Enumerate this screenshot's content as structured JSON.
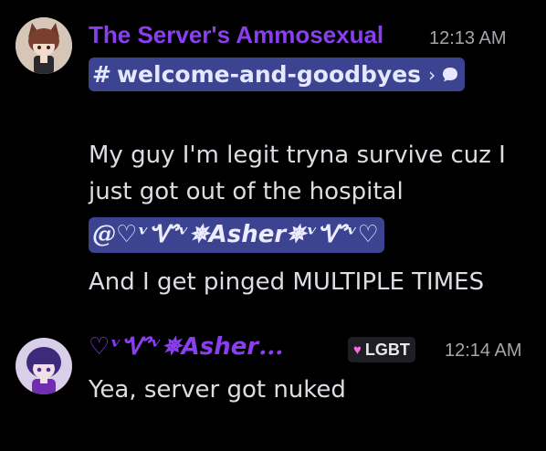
{
  "messages": [
    {
      "author": "The Server's Ammosexual",
      "author_color": "#8b3ef0",
      "time": "12:13 AM",
      "channel": {
        "hash": "#",
        "name": "welcome-and-goodbyes",
        "chevron": "›",
        "bubble_icon": "chat-bubble-icon"
      },
      "lines": [
        "My guy I'm legit tryna survive cuz I",
        "just got out of the hospital"
      ],
      "mention": "@♡ᵛᏉᵛ✵𝘼𝙨𝙝𝙚𝙧✵ᵛᏉᵛ♡",
      "line_after": "And I get pinged MULTIPLE TIMES"
    },
    {
      "author": "♡ᵛᏉᵛ✵𝘼𝙨𝙝𝙚𝙧...",
      "author_color": "#8b3ef0",
      "badge": {
        "icon": "heart-icon",
        "label": "LGBT"
      },
      "time": "12:14 AM",
      "lines": [
        "Yea, server got nuked"
      ]
    }
  ]
}
